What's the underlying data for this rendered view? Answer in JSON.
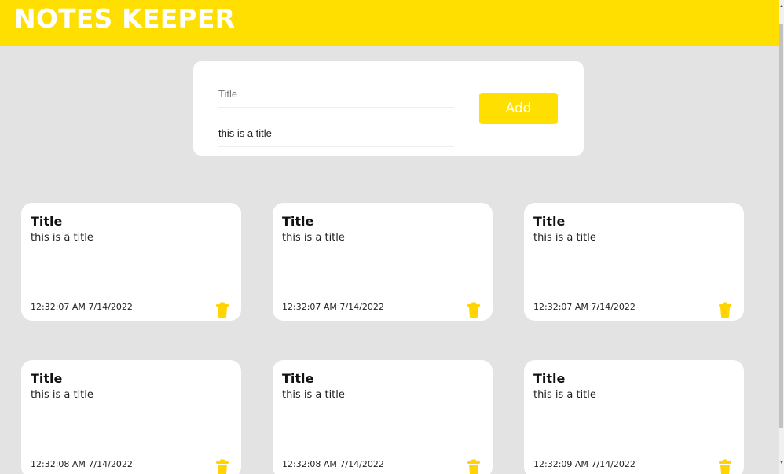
{
  "app": {
    "title": "NOTES KEEPER",
    "accent": "#ffdf00"
  },
  "form": {
    "title_placeholder": "Title",
    "body_value": "this is a title",
    "add_label": "Add"
  },
  "notes": [
    {
      "title": "Title",
      "body": "this is a title",
      "time": "12:32:07 AM 7/14/2022",
      "delete_icon": "trash-icon"
    },
    {
      "title": "Title",
      "body": "this is a title",
      "time": "12:32:07 AM 7/14/2022",
      "delete_icon": "trash-icon"
    },
    {
      "title": "Title",
      "body": "this is a title",
      "time": "12:32:07 AM 7/14/2022",
      "delete_icon": "trash-icon"
    },
    {
      "title": "Title",
      "body": "this is a title",
      "time": "12:32:08 AM 7/14/2022",
      "delete_icon": "trash-icon"
    },
    {
      "title": "Title",
      "body": "this is a title",
      "time": "12:32:08 AM 7/14/2022",
      "delete_icon": "trash-icon"
    },
    {
      "title": "Title",
      "body": "this is a title",
      "time": "12:32:09 AM 7/14/2022",
      "delete_icon": "trash-icon"
    }
  ]
}
